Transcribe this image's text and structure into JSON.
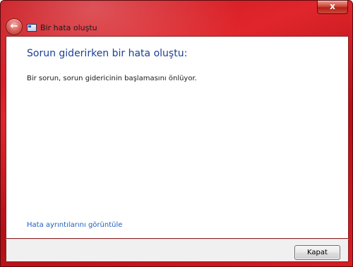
{
  "window": {
    "title": "Bir hata oluştu",
    "close_glyph": "x",
    "back_glyph": "←",
    "frame_color": "#c8121a"
  },
  "content": {
    "heading": "Sorun giderirken bir hata oluştu:",
    "message": "Bir sorun, sorun gidericinin başlamasını önlüyor.",
    "details_link": "Hata ayrıntılarını görüntüle"
  },
  "footer": {
    "close_button_label": "Kapat"
  },
  "icons": {
    "back": "back-arrow-icon",
    "app": "troubleshooter-app-icon",
    "close": "close-icon"
  }
}
